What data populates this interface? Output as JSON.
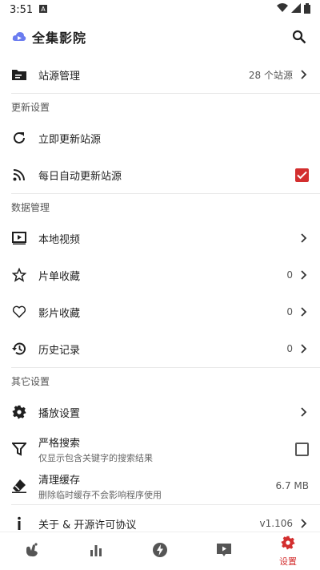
{
  "status_bar": {
    "time": "3:51",
    "icons": [
      "notification-a-icon",
      "wifi-icon",
      "signal-icon",
      "battery-icon"
    ]
  },
  "app_bar": {
    "title": "全集影院",
    "search_icon": "search-icon"
  },
  "source_row": {
    "label": "站源管理",
    "value": "28 个站源"
  },
  "sections": {
    "update": {
      "header": "更新设置",
      "update_now": "立即更新站源",
      "auto_update": "每日自动更新站源",
      "auto_update_checked": true
    },
    "data": {
      "header": "数据管理",
      "local_video": "本地视频",
      "playlist_fav": {
        "label": "片单收藏",
        "value": "0"
      },
      "movie_fav": {
        "label": "影片收藏",
        "value": "0"
      },
      "history": {
        "label": "历史记录",
        "value": "0"
      }
    },
    "other": {
      "header": "其它设置",
      "playback": "播放设置",
      "strict_search": {
        "label": "严格搜索",
        "sub": "仅显示包含关键字的搜索结果",
        "checked": false
      },
      "clear_cache": {
        "label": "清理缓存",
        "sub": "删除临时缓存不会影响程序使用",
        "value": "6.7 MB"
      },
      "about": {
        "label": "关于 & 开源许可协议",
        "value": "v1.106"
      }
    }
  },
  "bottom_nav": {
    "tabs": [
      "home-icon",
      "chart-icon",
      "flash-icon",
      "video-icon",
      "settings-icon"
    ],
    "active_label": "设置"
  },
  "colors": {
    "accent": "#d32f2f"
  }
}
